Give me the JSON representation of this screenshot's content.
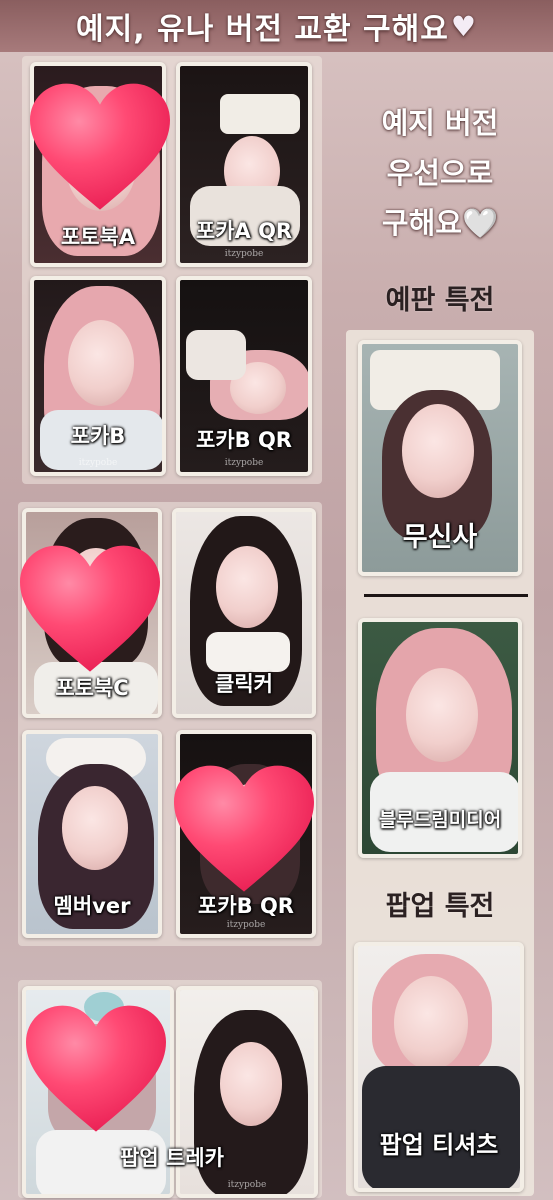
{
  "title": {
    "text": "예지, 유나 버전 교환 구해요",
    "heart": "🤍"
  },
  "side_note": {
    "lines": [
      "예지 버전",
      "우선으로",
      "구해요🤍"
    ]
  },
  "sections": {
    "presale": "예판 특전",
    "popup": "팝업 특전"
  },
  "cards": [
    {
      "label": "포토북A",
      "covered": true
    },
    {
      "label": "포카A QR",
      "covered": false
    },
    {
      "label": "포카B",
      "covered": false
    },
    {
      "label": "포카B QR",
      "covered": false
    },
    {
      "label": "포토북C",
      "covered": true
    },
    {
      "label": "클릭커",
      "covered": false
    },
    {
      "label": "멤버ver",
      "covered": false
    },
    {
      "label": "포카B QR",
      "covered": true
    },
    {
      "label": "팝업 트레카",
      "covered": true
    },
    {
      "label": "",
      "covered": false
    }
  ],
  "benefit_cards": [
    {
      "label": "무신사"
    },
    {
      "label": "블루드림미디어"
    },
    {
      "label": "팝업 티셔츠"
    }
  ],
  "watermark": "itzypobe",
  "colors": {
    "heart": "#ff3b6b",
    "card_border": "#f3eee6"
  }
}
